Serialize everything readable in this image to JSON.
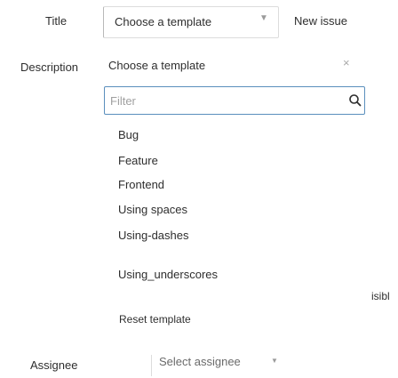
{
  "form": {
    "title_label": "Title",
    "description_label": "Description",
    "assignee_label": "Assignee",
    "assignee_placeholder": "Select assignee",
    "new_issue_link": "New issue"
  },
  "template_select": {
    "value": "Choose a template",
    "chevron_icon": "chevron-down-icon"
  },
  "dropdown": {
    "title": "Choose a template",
    "close_glyph": "×",
    "filter_placeholder": "Filter",
    "items": [
      {
        "label": "Bug"
      },
      {
        "label": "Feature"
      },
      {
        "label": "Frontend"
      },
      {
        "label": "Using spaces"
      },
      {
        "label": "Using-dashes"
      },
      {
        "label": "Using_underscores"
      }
    ],
    "reset_label": "Reset template",
    "clipped_text": "isibl"
  },
  "colors": {
    "focus_border": "#5a8fbd",
    "text": "#2e2e2e",
    "muted": "#a0a0a0"
  }
}
